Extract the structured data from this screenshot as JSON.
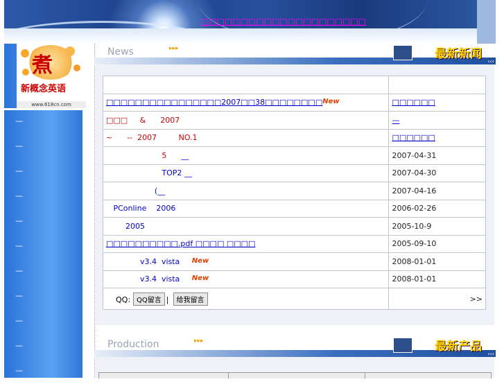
{
  "banner": {
    "link": "□□□□□□□□□□□□□□□□□□□□□"
  },
  "logo": {
    "char": "煮",
    "name": "新概念英语",
    "url": "www.618cn.com"
  },
  "left_nav": {
    "items": [
      "—",
      "—",
      "—",
      "—",
      "—",
      "—",
      "—",
      "—",
      "—",
      "—",
      "—"
    ]
  },
  "news_section": {
    "title_en": "News",
    "arrows": "▸▸▸",
    "title_cn": "最新新闻",
    "corner": "‹‹‹",
    "rows": [
      {
        "cells": [
          [
            {
              "t": "□□□□□□□□□□□□□□□□2007□□38□□□□□□□□",
              "c": "t-blue u"
            },
            {
              "t": "New",
              "c": "new"
            }
          ],
          [
            {
              "t": "□□□□□□",
              "c": "t-blue u"
            }
          ]
        ]
      },
      {
        "cells": [
          [
            {
              "t": "□□□",
              "c": "t-red"
            },
            {
              "t": "     &      2007",
              "c": "t-red"
            }
          ],
          [
            {
              "t": "—",
              "c": "t-blue u"
            }
          ]
        ]
      },
      {
        "cells": [
          [
            {
              "t": "~      --  2007         NO.1",
              "c": "t-red"
            }
          ],
          [
            {
              "t": "□□□□□□",
              "c": "t-blue u"
            }
          ]
        ]
      },
      {
        "cells": [
          [
            {
              "t": "                       5      ",
              "c": "t-red"
            },
            {
              "t": "__",
              "c": "t-blue"
            }
          ],
          [
            {
              "t": "2007-04-31",
              "c": ""
            }
          ]
        ]
      },
      {
        "cells": [
          [
            {
              "t": "                       TOP2 ",
              "c": "t-blue"
            },
            {
              "t": "__",
              "c": "t-blue"
            }
          ],
          [
            {
              "t": "2007-04-30",
              "c": ""
            }
          ]
        ]
      },
      {
        "cells": [
          [
            {
              "t": "                    (",
              "c": "t-blue"
            },
            {
              "t": "__",
              "c": "t-blue"
            }
          ],
          [
            {
              "t": "2007-04-16",
              "c": ""
            }
          ]
        ]
      },
      {
        "cells": [
          [
            {
              "t": "   PConline    2006",
              "c": "t-blue"
            }
          ],
          [
            {
              "t": "2006-02-26",
              "c": ""
            }
          ]
        ]
      },
      {
        "cells": [
          [
            {
              "t": "        2005",
              "c": "t-blue"
            }
          ],
          [
            {
              "t": "2005-10-9",
              "c": ""
            }
          ]
        ]
      },
      {
        "cells": [
          [
            {
              "t": "□□□□□□□□□□.pdf □□□□ □□□□",
              "c": "t-blue u"
            }
          ],
          [
            {
              "t": "2005-09-10",
              "c": ""
            }
          ]
        ]
      },
      {
        "cells": [
          [
            {
              "t": "              v3.4  vista     ",
              "c": "t-blue"
            },
            {
              "t": "New",
              "c": "new"
            }
          ],
          [
            {
              "t": "2008-01-01",
              "c": ""
            }
          ]
        ]
      },
      {
        "cells": [
          [
            {
              "t": "              v3.4  vista     ",
              "c": "t-blue"
            },
            {
              "t": "New",
              "c": "new"
            }
          ],
          [
            {
              "t": "2008-01-01",
              "c": ""
            }
          ]
        ]
      }
    ],
    "qq_label": "QQ:",
    "qq_btn1": "QQ留言",
    "qq_btn2": "给我留言",
    "more": ">>"
  },
  "product_section": {
    "title_en": "Production",
    "arrows": "▸▸▸",
    "title_cn": "最新产品",
    "corner": "‹‹‹"
  }
}
